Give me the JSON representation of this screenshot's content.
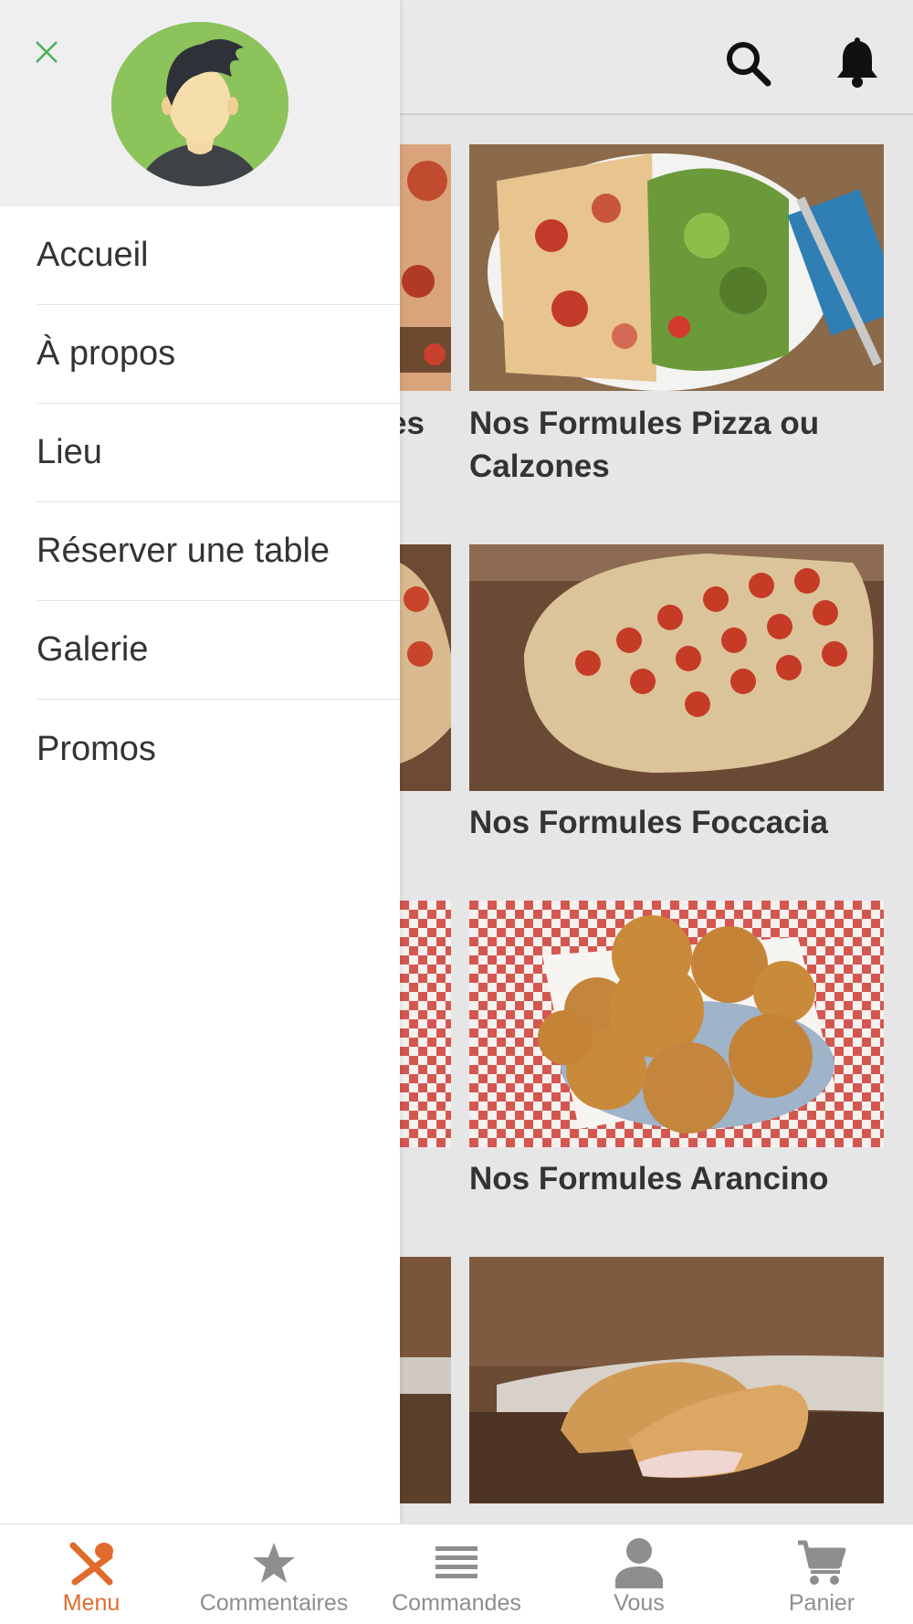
{
  "colors": {
    "accent": "#e06b2c",
    "close_icon": "#4caf50",
    "avatar_bg": "#8cc35b",
    "inactive": "#8e8e8e"
  },
  "drawer": {
    "close_icon": "close-icon",
    "avatar_icon": "user-avatar",
    "items": [
      {
        "label": "Accueil"
      },
      {
        "label": "À propos"
      },
      {
        "label": "Lieu"
      },
      {
        "label": "Réserver une table"
      },
      {
        "label": "Galerie"
      },
      {
        "label": "Promos"
      }
    ]
  },
  "topbar": {
    "icons": [
      "search-icon",
      "bell-icon"
    ]
  },
  "menu_cards": [
    {
      "title": "Nos Formules Pizza ou Calzones",
      "image": "pizza and salad plate"
    },
    {
      "title": "Nos Formules Foccacia",
      "image": "focaccia with tomatoes"
    },
    {
      "title": "Nos Formules Arancino",
      "image": "arancini on checkered cloth"
    },
    {
      "title": "",
      "image": "calzone on wooden board"
    }
  ],
  "left_partial_text": "es",
  "bottom_nav": {
    "tabs": [
      {
        "label": "Menu",
        "icon": "utensils-icon",
        "active": true
      },
      {
        "label": "Commentaires",
        "icon": "star-icon",
        "active": false
      },
      {
        "label": "Commandes",
        "icon": "list-icon",
        "active": false
      },
      {
        "label": "Vous",
        "icon": "person-icon",
        "active": false
      },
      {
        "label": "Panier",
        "icon": "cart-icon",
        "active": false
      }
    ]
  }
}
